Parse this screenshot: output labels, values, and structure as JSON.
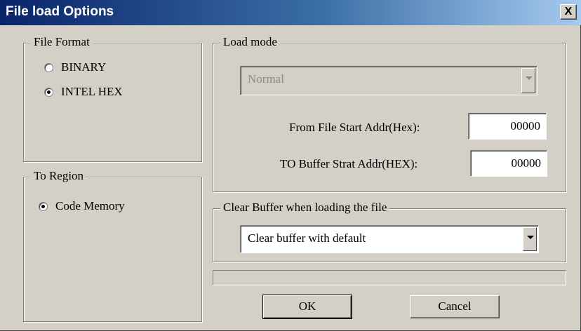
{
  "window": {
    "title": "File load Options",
    "close_label": "X"
  },
  "file_format": {
    "legend": "File Format",
    "options": [
      {
        "label": "BINARY",
        "selected": false
      },
      {
        "label": "INTEL HEX",
        "selected": true
      }
    ]
  },
  "to_region": {
    "legend": "To Region",
    "options": [
      {
        "label": "Code Memory",
        "selected": true
      }
    ]
  },
  "load_mode": {
    "legend": "Load mode",
    "mode_value": "Normal",
    "from_label": "From File Start Addr(Hex):",
    "from_value": "00000",
    "to_label": "TO Buffer Strat Addr(HEX):",
    "to_value": "00000"
  },
  "clear_buffer": {
    "legend": "Clear Buffer when loading the file",
    "value": "Clear buffer with default"
  },
  "progress": {
    "value": 0
  },
  "buttons": {
    "ok": "OK",
    "cancel": "Cancel"
  },
  "colors": {
    "titlebar_start": "#0a246a",
    "titlebar_end": "#a6caf0",
    "face": "#d4d0c8"
  },
  "icons": {
    "close": "close-icon",
    "dropdown": "chevron-down-icon"
  }
}
